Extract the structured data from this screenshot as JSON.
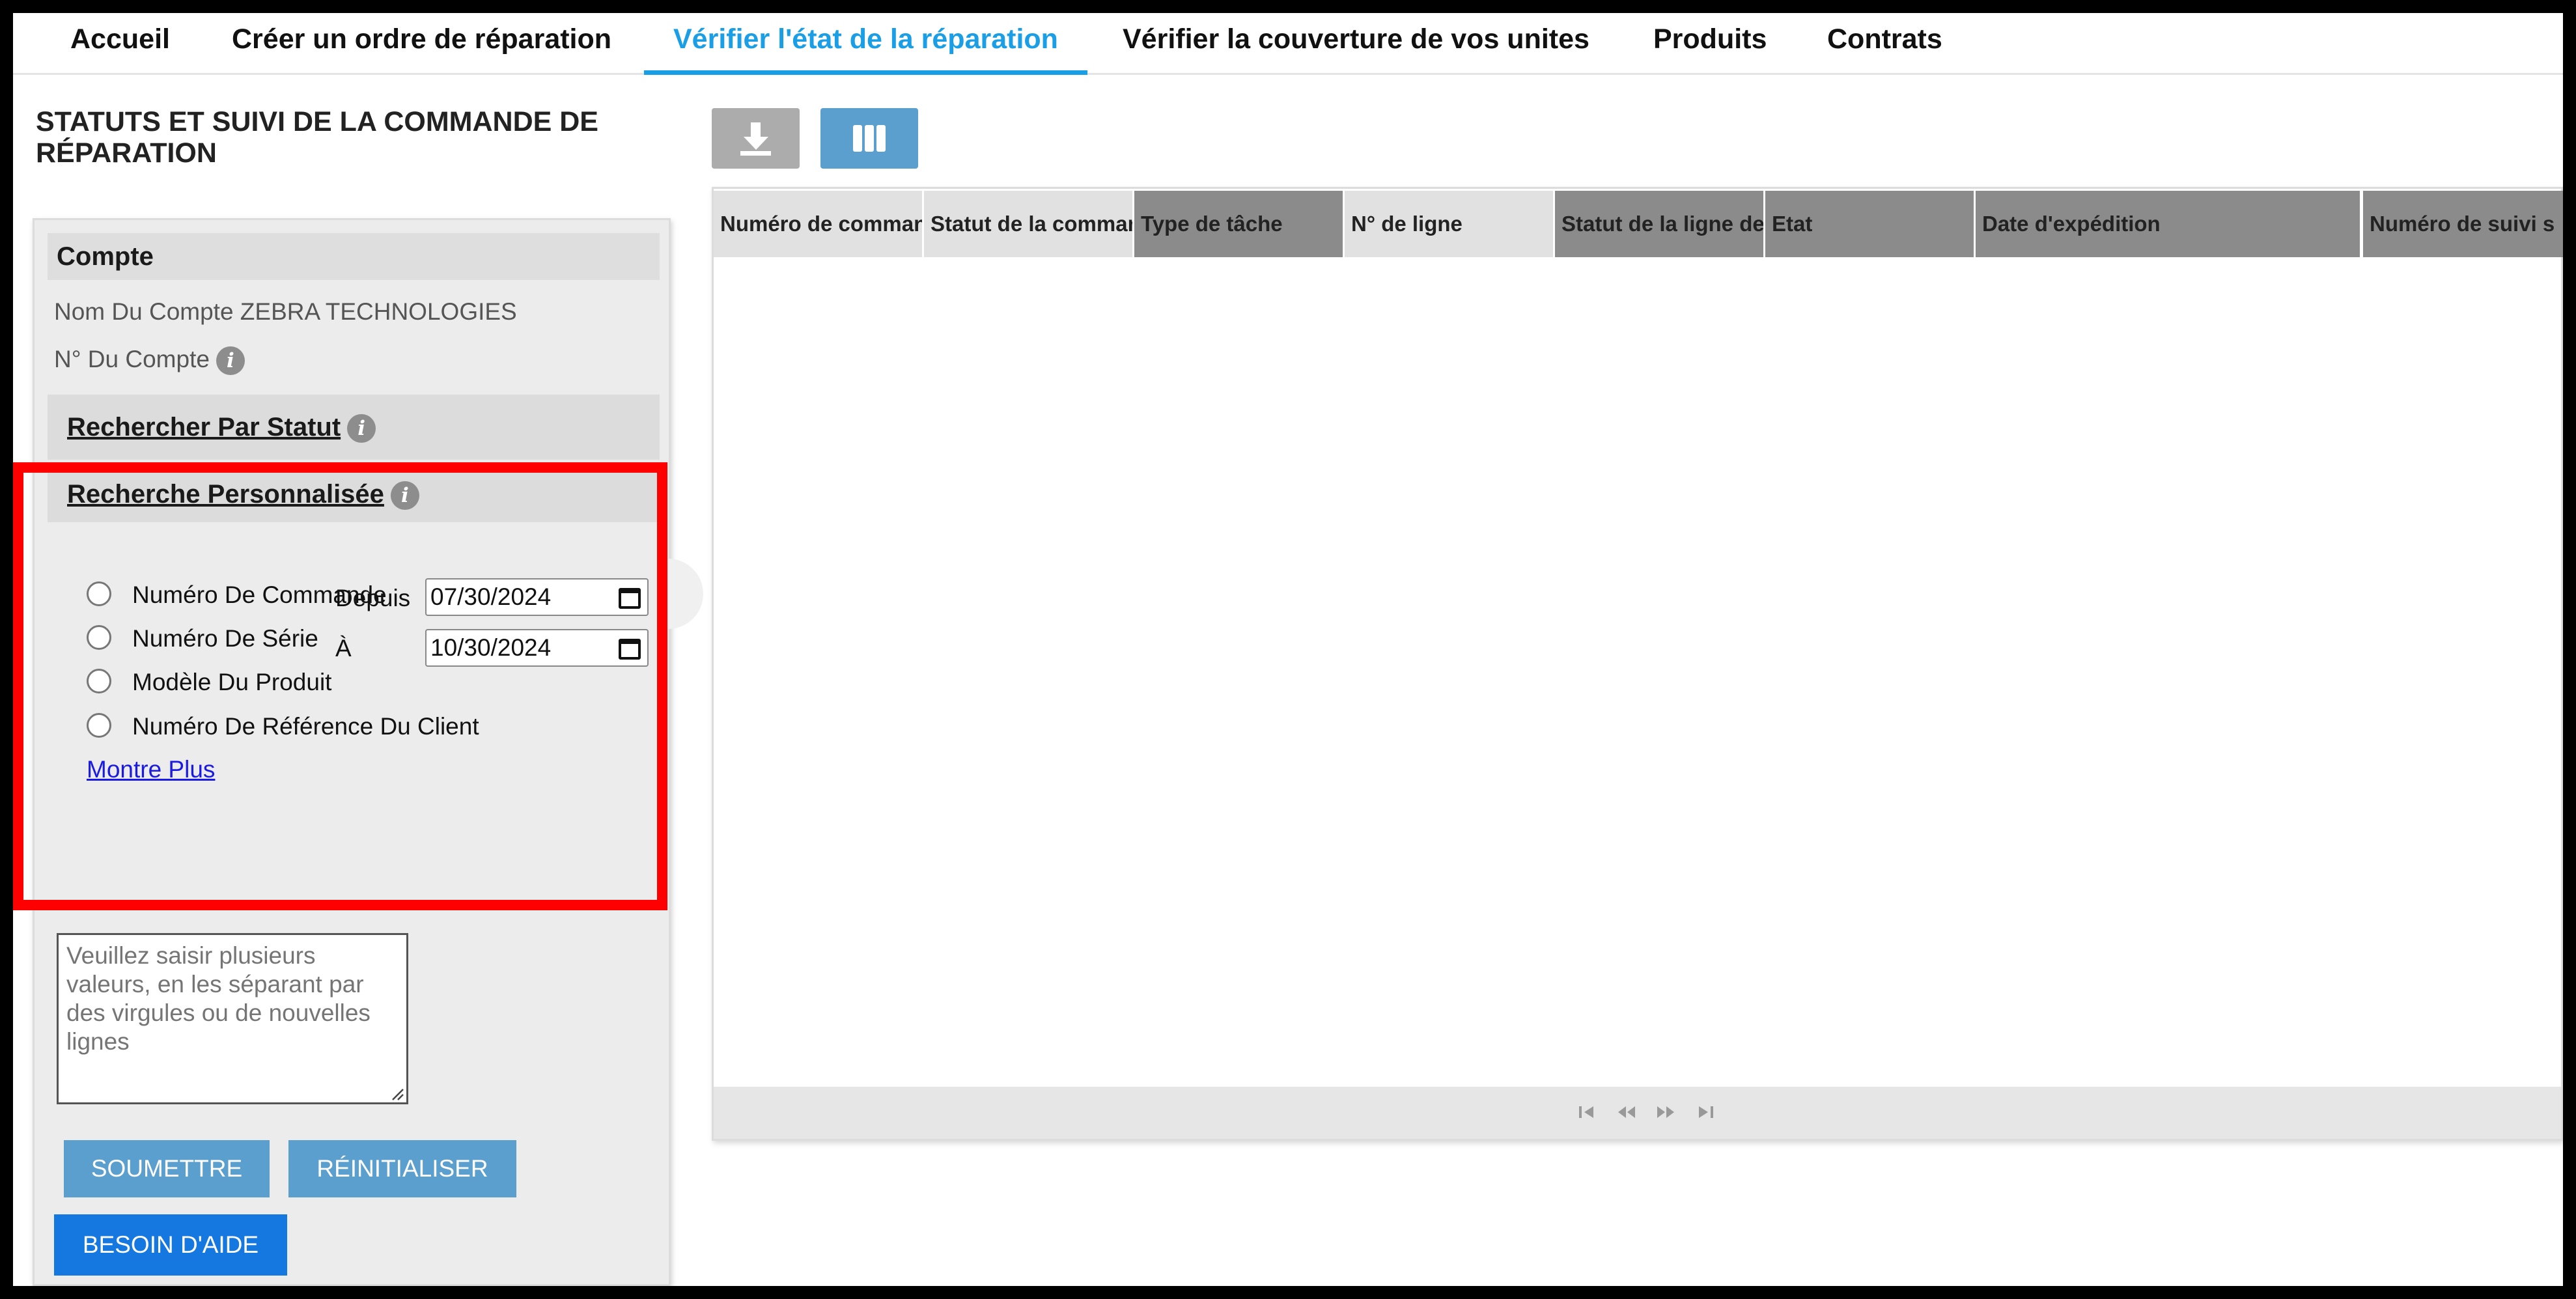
{
  "nav": {
    "tabs": [
      {
        "label": "Accueil"
      },
      {
        "label": "Créer un ordre de réparation"
      },
      {
        "label": "Vérifier l'état de la réparation",
        "active": true
      },
      {
        "label": "Vérifier la couverture de vos unites"
      },
      {
        "label": "Produits"
      },
      {
        "label": "Contrats"
      }
    ],
    "active_color": "#1a9ee6"
  },
  "page_title": "STATUTS ET SUIVI DE LA COMMANDE DE RÉPARATION",
  "account": {
    "header": "Compte",
    "name_line": "Nom Du Compte ZEBRA TECHNOLOGIES",
    "number_label": "N° Du Compte"
  },
  "search_by_status": {
    "label": "Rechercher Par Statut"
  },
  "custom_search": {
    "label": "Recherche Personnalisée",
    "options": [
      {
        "label": "Numéro De Commande"
      },
      {
        "label": "Numéro De Série"
      },
      {
        "label": "Modèle Du Produit"
      },
      {
        "label": "Numéro De Référence Du Client"
      }
    ],
    "show_more": "Montre Plus",
    "from_label": "Depuis",
    "from_value": "07/30/2024",
    "to_label": "À",
    "to_value": "10/30/2024"
  },
  "multi_input": {
    "placeholder": "Veuillez saisir plusieurs valeurs, en les séparant par des virgules ou de nouvelles lignes"
  },
  "buttons": {
    "submit": "SOUMETTRE",
    "reset": "RÉINITIALISER",
    "help": "BESOIN D'AIDE"
  },
  "toolbar": {
    "download_icon": "download-icon",
    "columns_icon": "columns-icon"
  },
  "grid": {
    "columns": [
      "Numéro de commande",
      "Statut de la commande",
      "Type de tâche",
      "N° de ligne",
      "Statut de la ligne de commande",
      "Etat",
      "Date d'expédition",
      "Numéro de suivi s"
    ],
    "rows": [],
    "pager_icons": [
      "first-page-icon",
      "prev-page-icon",
      "next-page-icon",
      "last-page-icon"
    ]
  },
  "colors": {
    "accent": "#1a9ee6",
    "button": "#5a9fce",
    "help_button": "#1577e0",
    "highlight": "#ff0000"
  }
}
